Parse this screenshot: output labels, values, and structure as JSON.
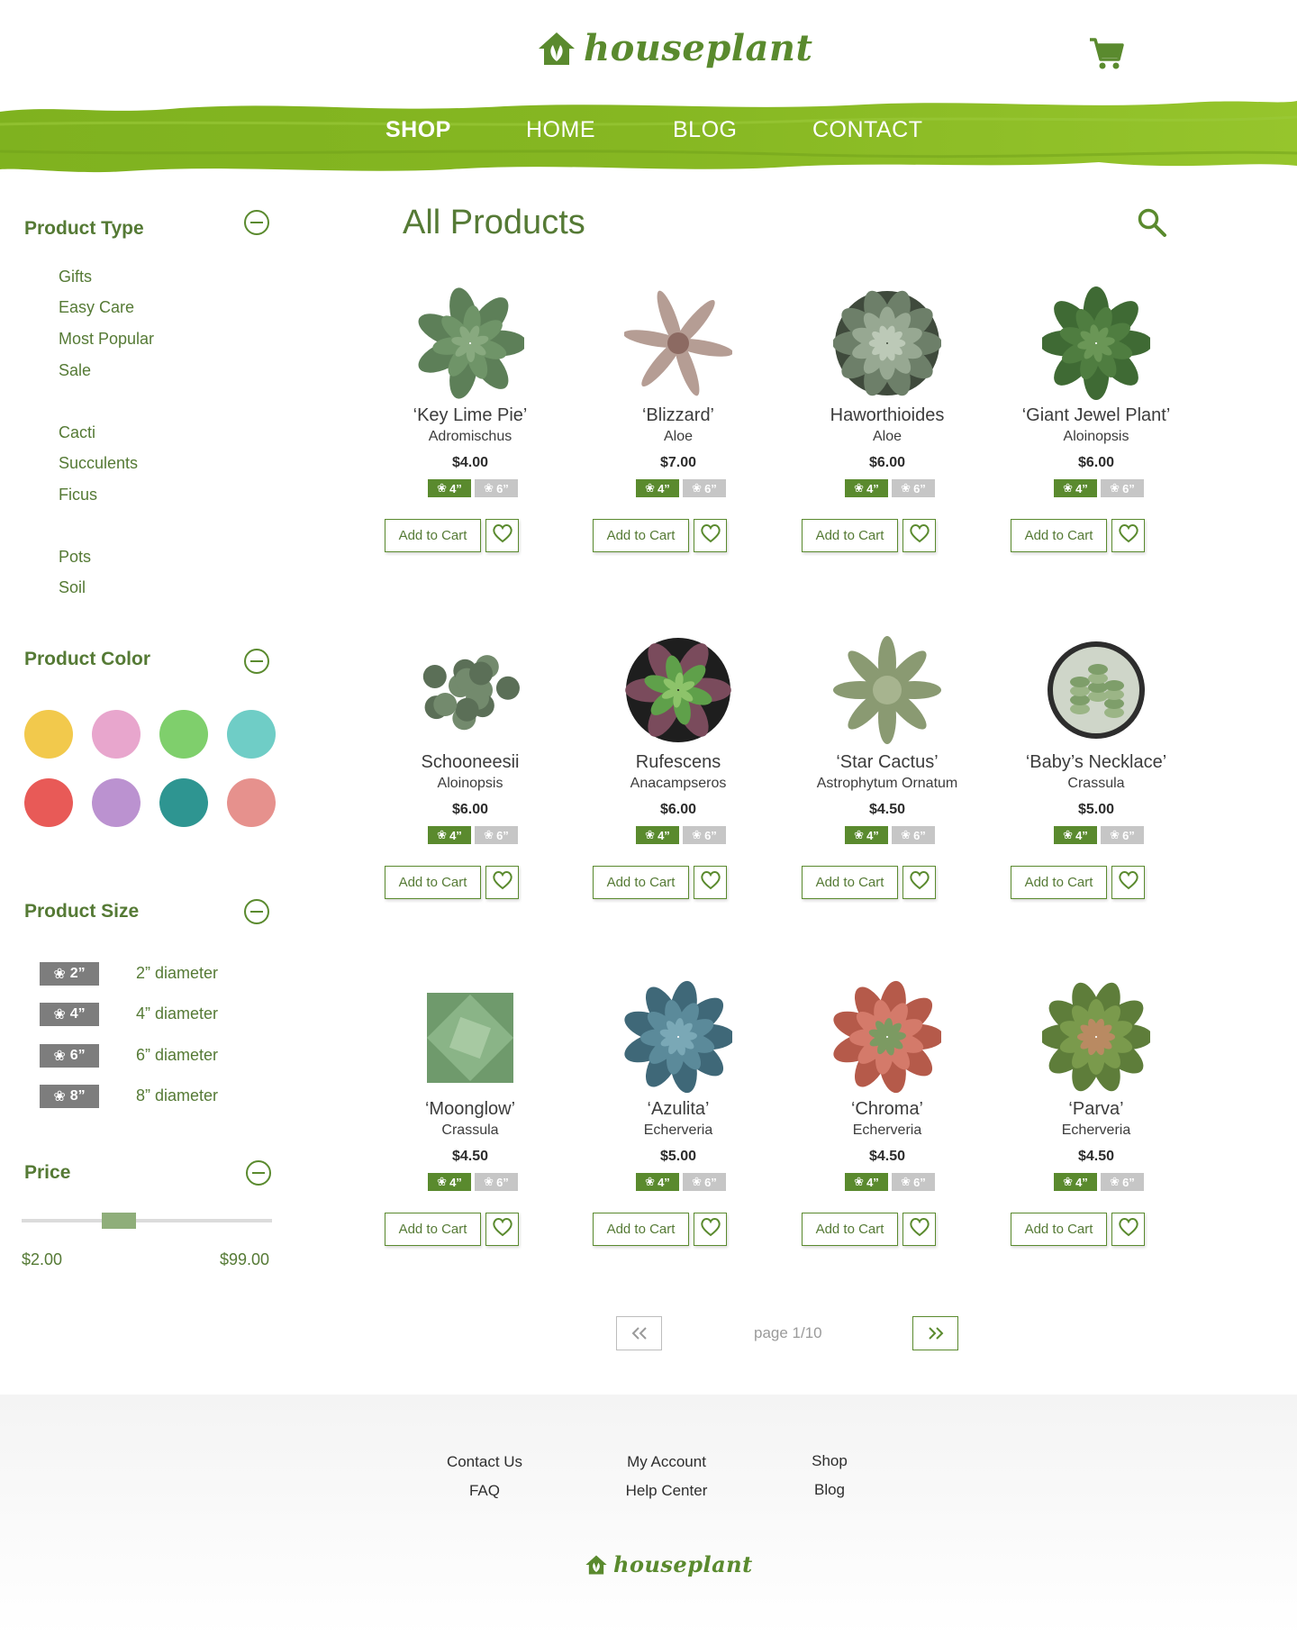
{
  "brand": {
    "name": "houseplant",
    "color": "#5a8a2e"
  },
  "nav": {
    "items": [
      {
        "label": "SHOP",
        "active": true
      },
      {
        "label": "HOME",
        "active": false
      },
      {
        "label": "BLOG",
        "active": false
      },
      {
        "label": "CONTACT",
        "active": false
      }
    ]
  },
  "sidebar": {
    "product_type": {
      "title": "Product Type",
      "items": [
        "Gifts",
        "Easy Care",
        "Most Popular",
        "Sale",
        "Cacti",
        "Succulents",
        "Ficus",
        "Pots",
        "Soil"
      ]
    },
    "product_color": {
      "title": "Product Color",
      "swatches": [
        "#f2c94c",
        "#e8a6cd",
        "#7fcf6c",
        "#6fcdc6",
        "#e85a57",
        "#bb92d0",
        "#2e9591",
        "#e6918d"
      ]
    },
    "product_size": {
      "title": "Product Size",
      "sizes": [
        {
          "badge": "2”",
          "label": "2” diameter",
          "icon": "leaf-1-icon"
        },
        {
          "badge": "4”",
          "label": "4” diameter",
          "icon": "leaf-2-icon"
        },
        {
          "badge": "6”",
          "label": "6” diameter",
          "icon": "leaf-3-icon"
        },
        {
          "badge": "8”",
          "label": "8” diameter",
          "icon": "leaf-4-icon"
        }
      ]
    },
    "price": {
      "title": "Price",
      "min": "$2.00",
      "max": "$99.00"
    }
  },
  "main": {
    "title": "All Products",
    "add_to_cart_label": "Add to Cart",
    "size_small": "4”",
    "size_large": "6”",
    "products": [
      {
        "name": "‘Key Lime Pie’",
        "genus": "Adromischus",
        "price": "$4.00",
        "plant": "spiky-green"
      },
      {
        "name": "‘Blizzard’",
        "genus": "Aloe",
        "price": "$7.00",
        "plant": "star-speckled"
      },
      {
        "name": "Haworthioides",
        "genus": "Aloe",
        "price": "$6.00",
        "plant": "round-spiky"
      },
      {
        "name": "‘Giant Jewel Plant’",
        "genus": "Aloinopsis",
        "price": "$6.00",
        "plant": "rosette-dark"
      },
      {
        "name": "Schooneesii",
        "genus": "Aloinopsis",
        "price": "$6.00",
        "plant": "pebbles"
      },
      {
        "name": "Rufescens",
        "genus": "Anacampseros",
        "price": "$6.00",
        "plant": "purple-rosette"
      },
      {
        "name": "‘Star Cactus’",
        "genus": "Astrophytum Ornatum",
        "price": "$4.50",
        "plant": "star-cactus"
      },
      {
        "name": "‘Baby’s Necklace’",
        "genus": "Crassula",
        "price": "$5.00",
        "plant": "stacked"
      },
      {
        "name": "‘Moonglow’",
        "genus": "Crassula",
        "price": "$4.50",
        "plant": "square-rosette"
      },
      {
        "name": "‘Azulita’",
        "genus": "Echerveria",
        "price": "$5.00",
        "plant": "blue-rosette"
      },
      {
        "name": "‘Chroma’",
        "genus": "Echerveria",
        "price": "$4.50",
        "plant": "pink-rosette"
      },
      {
        "name": "‘Parva’",
        "genus": "Echerveria",
        "price": "$4.50",
        "plant": "green-rosette"
      }
    ]
  },
  "pagination": {
    "label": "page 1/10"
  },
  "footer": {
    "links": [
      "Contact Us",
      "FAQ",
      "My Account",
      "Help Center",
      "Shop",
      "Blog"
    ]
  }
}
